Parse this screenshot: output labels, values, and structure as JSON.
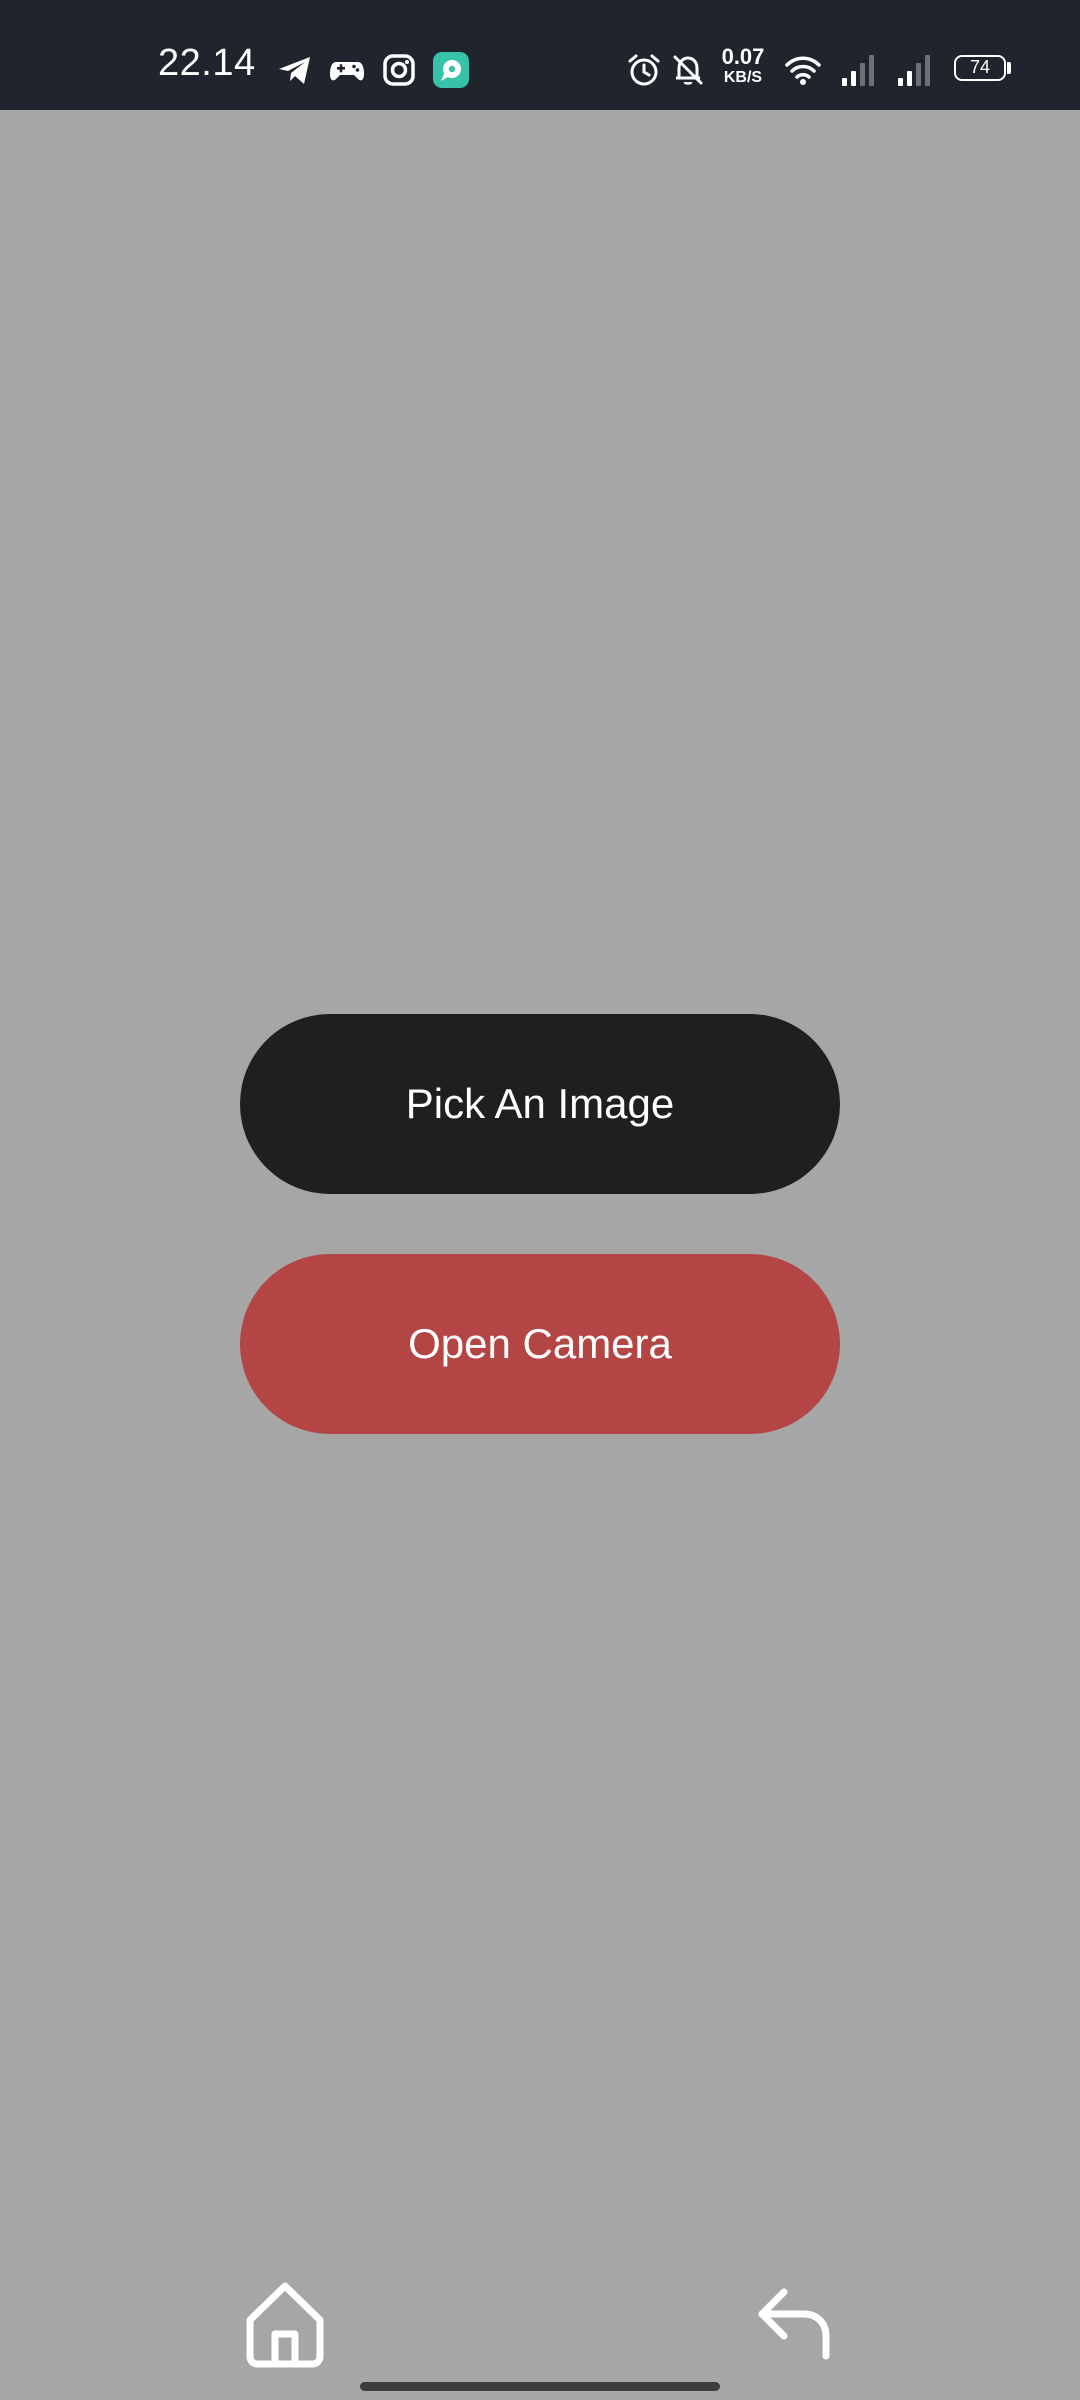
{
  "status_bar": {
    "time": "22.14",
    "net_speed_value": "0.07",
    "net_speed_unit": "KB/S",
    "battery_level": "74",
    "notification_icons": [
      "telegram-icon",
      "gamepad-icon",
      "instagram-icon",
      "chat-app-icon"
    ],
    "system_icons": [
      "alarm-icon",
      "bell-off-icon",
      "wifi-icon",
      "signal-icon",
      "signal-icon",
      "battery-icon"
    ]
  },
  "main": {
    "pick_image_label": "Pick An Image",
    "open_camera_label": "Open Camera"
  },
  "nav_bar": {
    "icons": [
      "home-icon",
      "back-icon"
    ]
  },
  "colors": {
    "background": "#a6a6a6",
    "status_bar": "#20242c",
    "pick_button": "#1f1f1f",
    "camera_button": "#b44545"
  }
}
